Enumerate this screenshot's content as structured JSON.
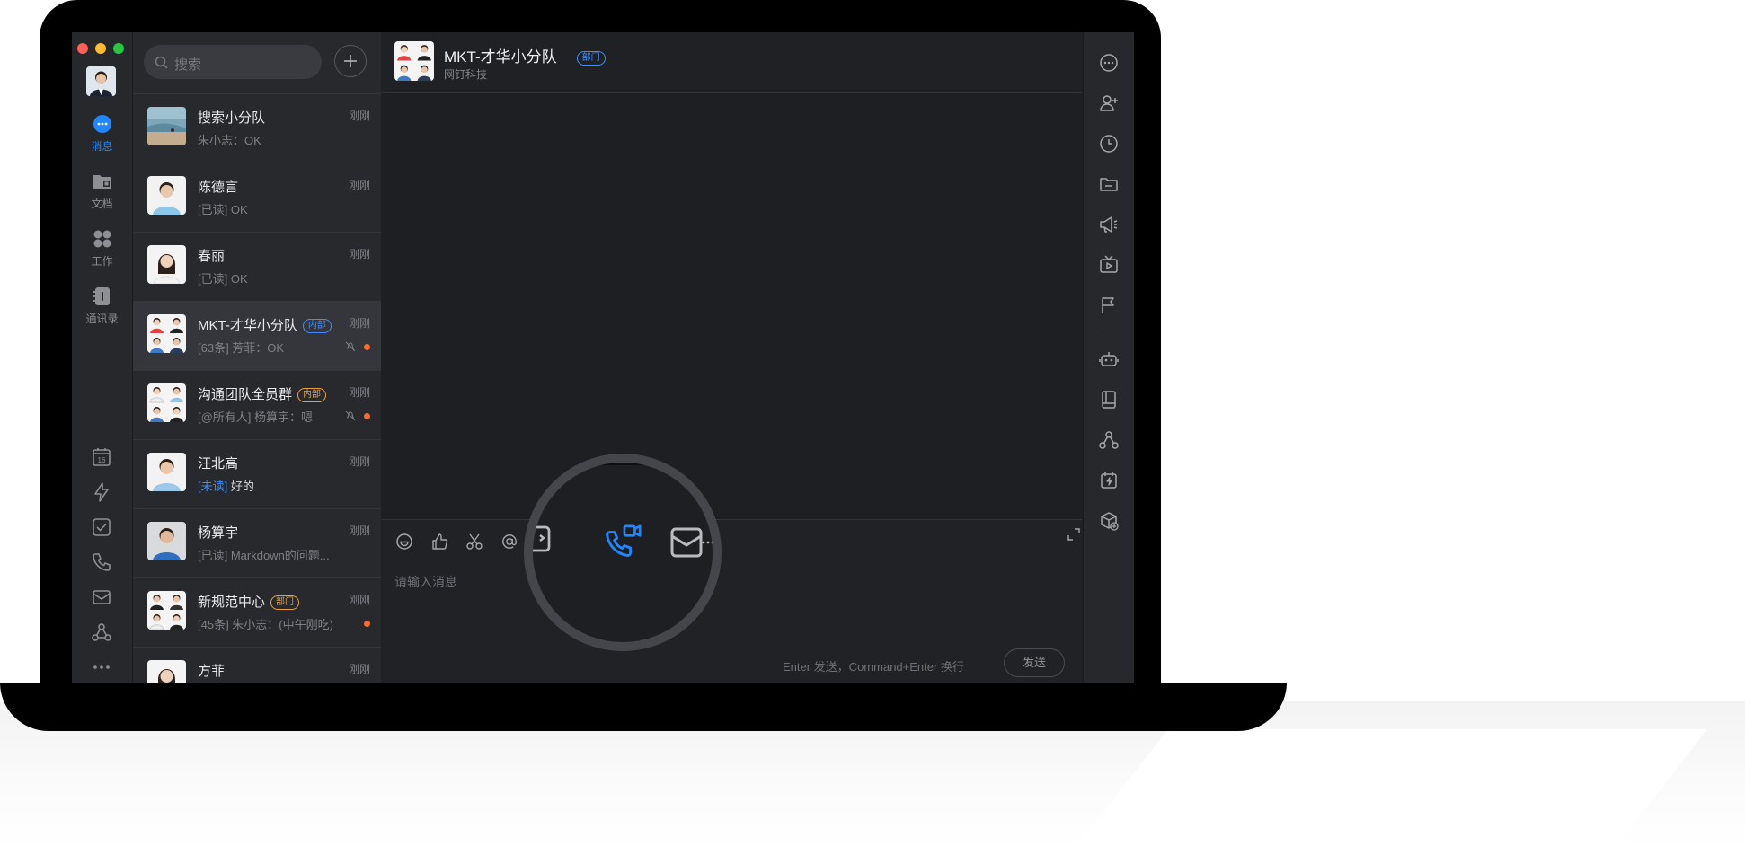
{
  "window": {
    "traffic_lights": {
      "close": "#ff5f57",
      "minimize": "#febc2e",
      "maximize": "#28c840"
    }
  },
  "nav": {
    "items": [
      {
        "label": "消息",
        "icon": "message-icon",
        "active": true
      },
      {
        "label": "文档",
        "icon": "folder-icon"
      },
      {
        "label": "工作",
        "icon": "apps-grid-icon"
      },
      {
        "label": "通讯录",
        "icon": "contacts-book-icon"
      }
    ],
    "tools": [
      "calendar-icon",
      "lightning-icon",
      "checkbox-icon",
      "phone-icon",
      "mail-icon",
      "network-icon",
      "more-icon"
    ],
    "calendar_day": "16"
  },
  "search": {
    "placeholder": "搜索"
  },
  "conversations": [
    {
      "name": "搜索小分队",
      "time": "刚刚",
      "preview": "朱小志：OK"
    },
    {
      "name": "陈德言",
      "time": "刚刚",
      "preview": "[已读] OK"
    },
    {
      "name": "春丽",
      "time": "刚刚",
      "preview": "[已读] OK"
    },
    {
      "name": "MKT-才华小分队",
      "tag": "内部",
      "time": "刚刚",
      "preview": "[63条] 芳菲：OK",
      "muted": true,
      "unread_dot": true,
      "active": true
    },
    {
      "name": "沟通团队全员群",
      "tag": "内部",
      "time": "刚刚",
      "preview": "[@所有人] 杨算宇：嗯",
      "muted": true,
      "unread_dot": true
    },
    {
      "name": "汪北高",
      "time": "刚刚",
      "preview_highlight": "[未读]",
      "preview": "好的"
    },
    {
      "name": "杨算宇",
      "time": "刚刚",
      "preview": "[已读] Markdown的问题..."
    },
    {
      "name": "新规范中心",
      "tag": "部门",
      "time": "刚刚",
      "preview": "[45条] 朱小志：(中午刚吃)",
      "unread_dot": true
    },
    {
      "name": "方菲",
      "time": "刚刚",
      "preview": ""
    }
  ],
  "chat": {
    "title": "MKT-才华小分队",
    "tag": "部门",
    "subtitle": "网钉科技",
    "composer": {
      "placeholder": "请输入消息",
      "hint": "Enter 发送，Command+Enter 换行",
      "send_label": "发送",
      "tools": [
        "emoji-icon",
        "thumbs-up-icon",
        "scissors-icon",
        "at-icon",
        "more-horizontal-icon"
      ],
      "expand_icon": "expand-icon"
    }
  },
  "right_rail": {
    "icons": [
      "more-circle-icon",
      "add-member-icon",
      "history-icon",
      "folder-icon",
      "announcement-icon",
      "live-tv-icon",
      "flag-icon",
      "robot-icon",
      "book-icon",
      "network-icon",
      "flash-calendar-icon",
      "box-add-icon"
    ]
  },
  "magnifier": {
    "highlighted_icon": "video-call-icon",
    "accent": "#1f87ff"
  },
  "colors": {
    "accent": "#1f87ff",
    "unread": "#ff6a2b",
    "tag_internal": "#3d8eff",
    "tag_dept": "#e9a23b"
  }
}
